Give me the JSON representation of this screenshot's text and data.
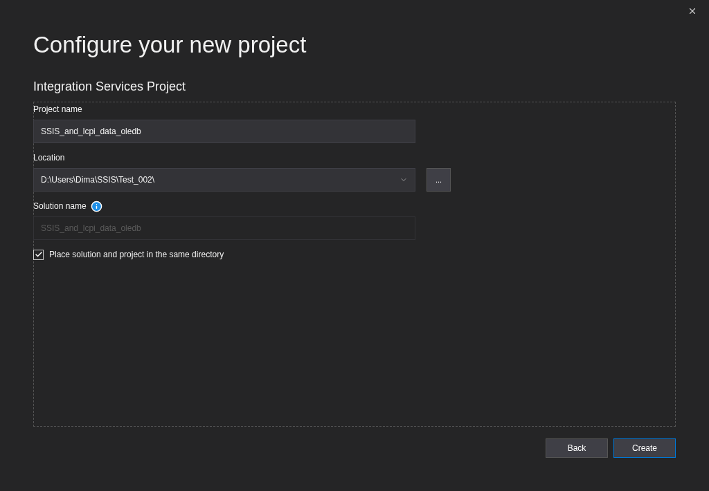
{
  "title": "Configure your new project",
  "project_type": "Integration Services Project",
  "fields": [
    {
      "kind": "text",
      "label": "Project name",
      "value": "SSIS_and_lcpi_data_oledb",
      "disabled": false
    },
    {
      "kind": "dropdown",
      "label": "Location",
      "value": "D:\\Users\\Dima\\SSIS\\Test_002\\",
      "disabled": false,
      "browse": "..."
    },
    {
      "kind": "info",
      "label": "Solution name",
      "value": "SSIS_and_lcpi_data_oledb",
      "disabled": true
    }
  ],
  "checkbox": {
    "label": "Place solution and project in the same directory",
    "checked": true
  },
  "buttons": [
    {
      "label": "Back",
      "selected": false
    },
    {
      "label": "Create",
      "selected": true
    }
  ]
}
